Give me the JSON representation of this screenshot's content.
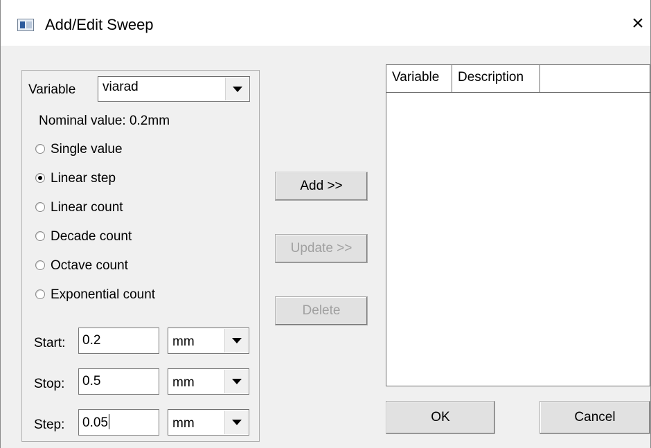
{
  "window": {
    "title": "Add/Edit Sweep",
    "close_glyph": "×"
  },
  "variable": {
    "label": "Variable",
    "value": "viarad"
  },
  "nominal": {
    "label": "Nominal value:",
    "value": "0.2mm"
  },
  "sweep_types": [
    {
      "label": "Single value",
      "selected": false
    },
    {
      "label": "Linear step",
      "selected": true
    },
    {
      "label": "Linear count",
      "selected": false
    },
    {
      "label": "Decade count",
      "selected": false
    },
    {
      "label": "Octave count",
      "selected": false
    },
    {
      "label": "Exponential count",
      "selected": false
    }
  ],
  "fields": {
    "start": {
      "label": "Start:",
      "value": "0.2",
      "unit": "mm"
    },
    "stop": {
      "label": "Stop:",
      "value": "0.5",
      "unit": "mm"
    },
    "step": {
      "label": "Step:",
      "value": "0.05",
      "unit": "mm"
    }
  },
  "buttons": {
    "add": "Add >>",
    "update": "Update >>",
    "delete": "Delete",
    "ok": "OK",
    "cancel": "Cancel"
  },
  "table": {
    "columns": [
      "Variable",
      "Description",
      ""
    ],
    "rows": []
  },
  "icons": {
    "window_icon": "app-window-icon",
    "close": "close-icon",
    "dropdown": "chevron-down-icon"
  }
}
